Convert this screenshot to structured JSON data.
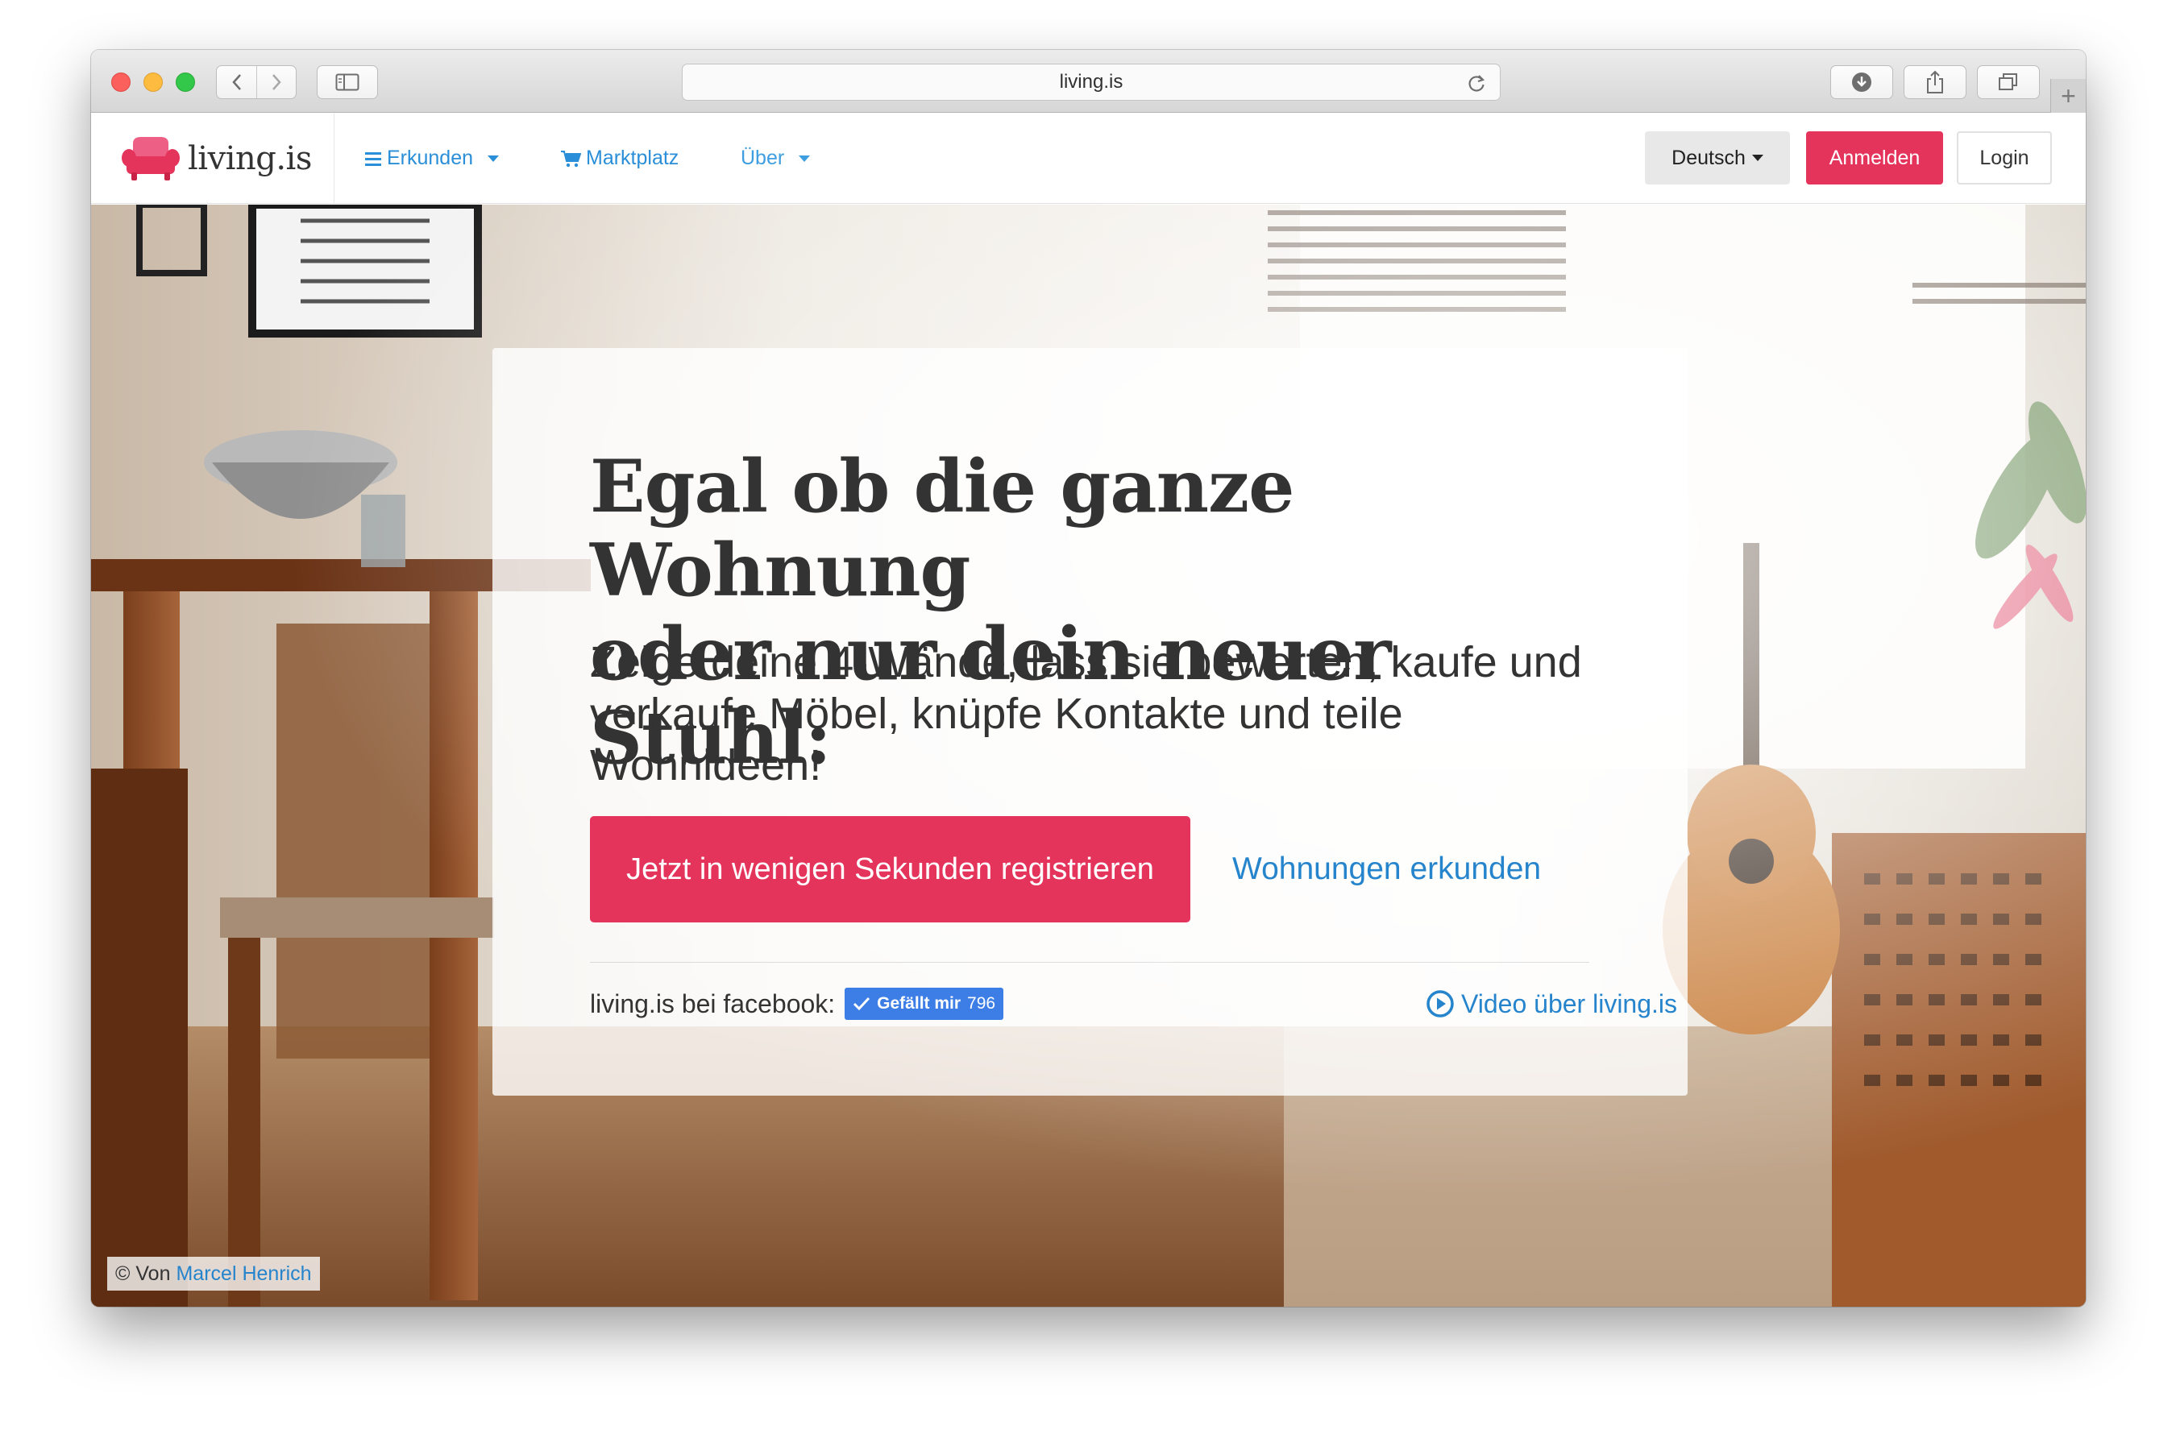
{
  "browser": {
    "url": "living.is",
    "icons": {
      "back": "chevron-left-icon",
      "forward": "chevron-right-icon",
      "sidebar": "sidebar-icon",
      "reload": "reload-icon",
      "download": "download-icon",
      "share": "share-icon",
      "tabs": "tabs-icon",
      "new_tab": "plus-icon"
    }
  },
  "site": {
    "brand": "living.is",
    "brand_icon": "armchair-icon",
    "nav": {
      "explore": "Erkunden",
      "market": "Marktplatz",
      "about": "Über"
    },
    "language": "Deutsch",
    "signup": "Anmelden",
    "login": "Login"
  },
  "hero": {
    "headline_line1": "Egal ob die ganze Wohnung",
    "headline_line2": "oder nur dein neuer Stuhl:",
    "subline": "Zeige deine 4-Wände, lass sie bewerten, kaufe und verkaufe Möbel, knüpfe Kontakte und teile Wohnideen!",
    "cta": "Jetzt in wenigen Sekunden registrieren",
    "explore_link": "Wohnungen erkunden",
    "facebook_label": "living.is bei facebook:",
    "facebook_like": "Gefällt mir",
    "facebook_count": "796",
    "video_link": "Video über living.is",
    "credit_prefix": "© Von",
    "credit_author": "Marcel Henrich"
  },
  "colors": {
    "accent": "#e5345b",
    "link": "#2584cc",
    "nav_link": "#2a8fd8",
    "facebook": "#3d7ee6"
  }
}
